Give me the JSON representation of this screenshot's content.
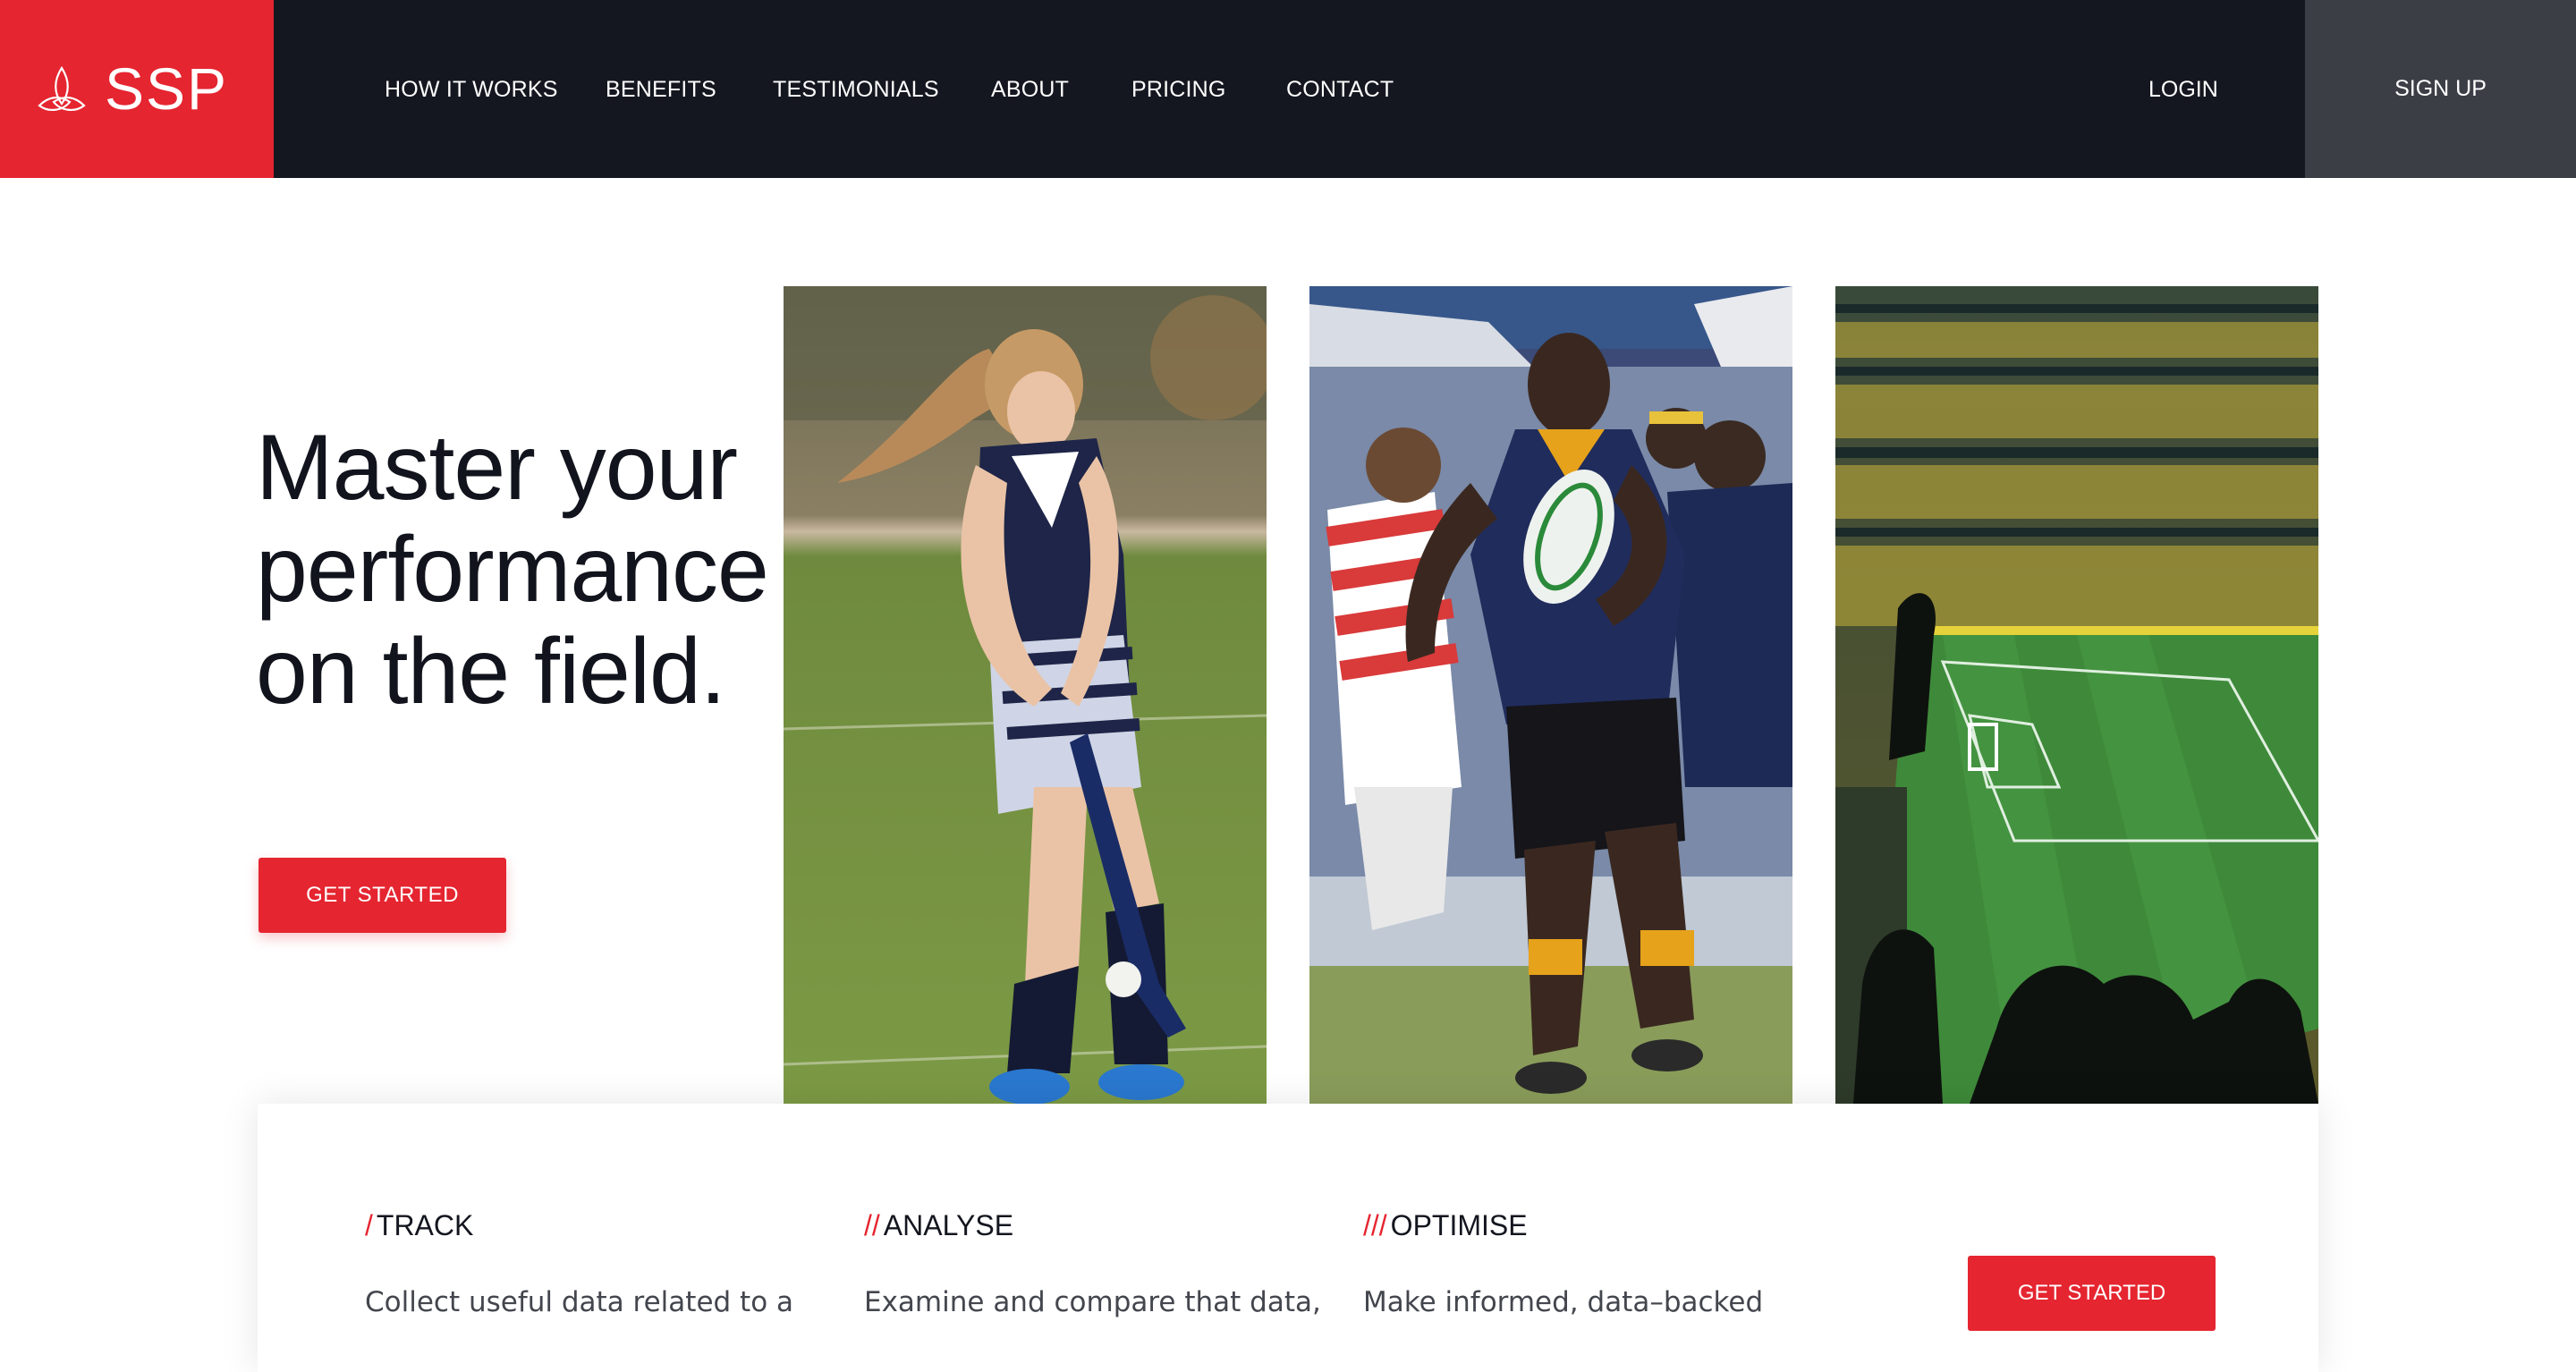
{
  "brand": {
    "name": "SSP",
    "accent": "#e52530",
    "icon": "triquetra-icon"
  },
  "nav": {
    "items": [
      {
        "label": "HOW IT WORKS"
      },
      {
        "label": "BENEFITS"
      },
      {
        "label": "TESTIMONIALS"
      },
      {
        "label": "ABOUT"
      },
      {
        "label": "PRICING"
      },
      {
        "label": "CONTACT"
      }
    ],
    "login": "LOGIN",
    "signup": "SIGN UP"
  },
  "hero": {
    "title_lines": [
      "Master your",
      "performance",
      "on the field."
    ],
    "cta": "GET STARTED"
  },
  "features": {
    "items": [
      {
        "slashes": "/",
        "title": "TRACK",
        "desc": "Collect useful data related to a"
      },
      {
        "slashes": "//",
        "title": "ANALYSE",
        "desc": "Examine and compare that data,"
      },
      {
        "slashes": "///",
        "title": "OPTIMISE",
        "desc": "Make informed, data–backed"
      }
    ],
    "cta": "GET STARTED"
  }
}
